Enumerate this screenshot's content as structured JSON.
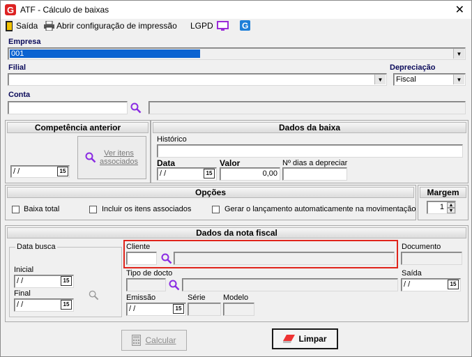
{
  "window": {
    "title": "ATF - Cálculo de baixas"
  },
  "toolbar": {
    "exit_label": "Saída",
    "print_config_label": "Abrir configuração de impressão",
    "lgpd_label": "LGPD"
  },
  "header": {
    "empresa_label": "Empresa",
    "empresa_value": "001",
    "filial_label": "Filial",
    "filial_value": "",
    "depreciacao_label": "Depreciação",
    "depreciacao_value": "Fiscal",
    "conta_label": "Conta",
    "conta_value": ""
  },
  "competencia": {
    "title": "Competência anterior",
    "date_value": "/ /",
    "ver_itens_label": "Ver itens associados"
  },
  "baixa": {
    "title": "Dados da baixa",
    "historico_label": "Histórico",
    "data_label": "Data",
    "data_value": "/ /",
    "valor_label": "Valor",
    "valor_value": "0,00",
    "dias_label": "Nº dias a depreciar"
  },
  "opcoes": {
    "title": "Opções",
    "baixa_total_label": "Baixa total",
    "incluir_itens_label": "Incluir os itens associados",
    "gerar_lancamento_label": "Gerar o lançamento automaticamente na movimentação"
  },
  "margem": {
    "title": "Margem",
    "value": "1"
  },
  "nota_fiscal": {
    "title": "Dados da nota fiscal",
    "data_busca_label": "Data busca",
    "inicial_label": "Inicial",
    "inicial_value": "/ /",
    "final_label": "Final",
    "final_value": "/ /",
    "cliente_label": "Cliente",
    "documento_label": "Documento",
    "tipo_docto_label": "Tipo de docto",
    "saida_label": "Saída",
    "saida_value": "/ /",
    "emissao_label": "Emissão",
    "emissao_value": "/ /",
    "serie_label": "Série",
    "modelo_label": "Modelo"
  },
  "actions": {
    "calcular_label": "Calcular",
    "limpar_label": "Limpar"
  },
  "colors": {
    "highlight": "#e0241b",
    "lgpd_monitor": "#9b2bd8",
    "brand_blue": "#1e7fd8"
  }
}
